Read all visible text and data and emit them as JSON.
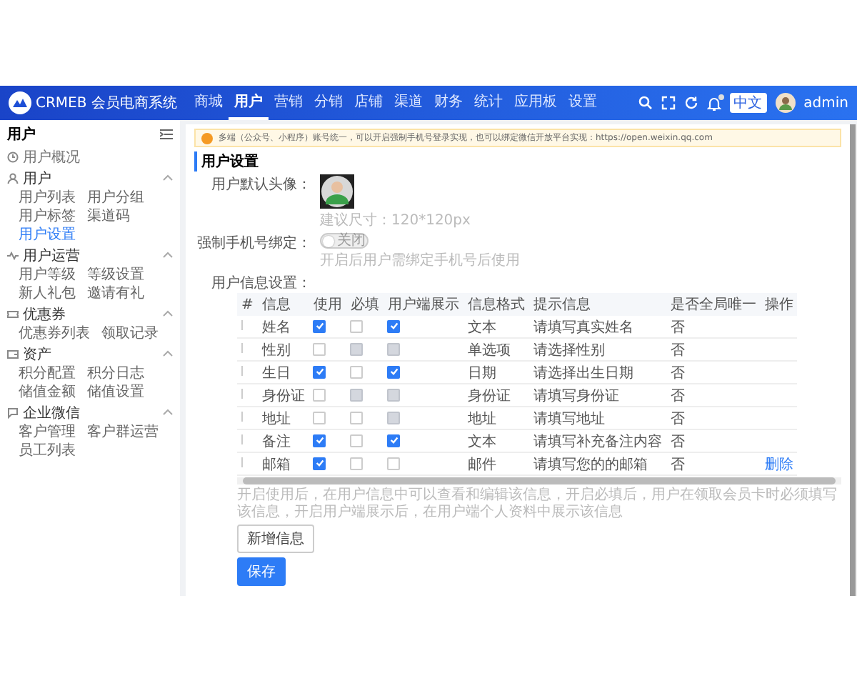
{
  "header": {
    "logo_text": "CRMEB 会员电商系统",
    "nav": [
      {
        "label": "商城",
        "selected": false
      },
      {
        "label": "用户",
        "selected": true
      },
      {
        "label": "营销",
        "selected": false
      },
      {
        "label": "分销",
        "selected": false
      },
      {
        "label": "店铺",
        "selected": false
      },
      {
        "label": "渠道",
        "selected": false
      },
      {
        "label": "财务",
        "selected": false
      },
      {
        "label": "统计",
        "selected": false
      },
      {
        "label": "应用板",
        "selected": false
      },
      {
        "label": "设置",
        "selected": false
      }
    ],
    "notification_dot": true,
    "tag": "中文",
    "user": "admin"
  },
  "sidebar": {
    "title": "用户",
    "groups": [
      {
        "label": "用户概况"
      },
      {
        "label": "用户",
        "expanded": true,
        "items": [
          {
            "label": "用户列表",
            "selected": false
          },
          {
            "label": "用户分组",
            "selected": false
          },
          {
            "label": "用户标签",
            "selected": false
          },
          {
            "label": "渠道码",
            "selected": false
          },
          {
            "label": "用户设置",
            "selected": true
          }
        ]
      },
      {
        "label": "用户运营",
        "expanded": true,
        "items": [
          {
            "label": "用户等级",
            "selected": false
          },
          {
            "label": "等级设置",
            "selected": false
          },
          {
            "label": "新人礼包",
            "selected": false
          },
          {
            "label": "邀请有礼",
            "selected": false
          }
        ]
      },
      {
        "label": "优惠券",
        "expanded": true,
        "items": [
          {
            "label": "优惠券列表",
            "selected": false
          },
          {
            "label": "领取记录",
            "selected": false
          }
        ]
      },
      {
        "label": "资产",
        "expanded": true,
        "items": [
          {
            "label": "积分配置",
            "selected": false
          },
          {
            "label": "积分日志",
            "selected": false
          },
          {
            "label": "储值金额",
            "selected": false
          },
          {
            "label": "储值设置",
            "selected": false
          }
        ]
      },
      {
        "label": "企业微信",
        "expanded": true,
        "items": [
          {
            "label": "客户管理",
            "selected": false
          },
          {
            "label": "客户群运营",
            "selected": false
          },
          {
            "label": "员工列表",
            "selected": false
          }
        ]
      }
    ]
  },
  "notice": "多端（公众号、小程序）账号统一，可以开启强制手机号登录实现，也可以绑定微信开放平台实现：https://open.weixin.qq.com",
  "section_title": "用户设置",
  "avatar": {
    "label": "用户默认头像：",
    "hint": "建议尺寸：120*120px"
  },
  "phone_toggle": {
    "label": "强制手机号绑定：",
    "on": false,
    "text": "关闭",
    "hint": "开启后用户需绑定手机号后使用"
  },
  "info_label": "用户信息设置：",
  "table": {
    "columns": [
      "#",
      "信息",
      "使用",
      "必填",
      "用户端展示",
      "信息格式",
      "提示信息",
      "是否全局唯一",
      "操作"
    ],
    "rows": [
      {
        "name": "姓名",
        "use": {
          "checked": true,
          "disabled": false
        },
        "required": {
          "checked": false,
          "disabled": false
        },
        "display": {
          "checked": true,
          "disabled": false
        },
        "format": "文本",
        "hint": "请填写真实姓名",
        "unique": "否"
      },
      {
        "name": "性别",
        "use": {
          "checked": false,
          "disabled": false
        },
        "required": {
          "checked": false,
          "disabled": true
        },
        "display": {
          "checked": false,
          "disabled": true
        },
        "format": "单选项",
        "hint": "请选择性别",
        "unique": "否"
      },
      {
        "name": "生日",
        "use": {
          "checked": true,
          "disabled": false
        },
        "required": {
          "checked": false,
          "disabled": false
        },
        "display": {
          "checked": true,
          "disabled": false
        },
        "format": "日期",
        "hint": "请选择出生日期",
        "unique": "否"
      },
      {
        "name": "身份证",
        "use": {
          "checked": false,
          "disabled": false
        },
        "required": {
          "checked": false,
          "disabled": true
        },
        "display": {
          "checked": false,
          "disabled": true
        },
        "format": "身份证",
        "hint": "请填写身份证",
        "unique": "否"
      },
      {
        "name": "地址",
        "use": {
          "checked": false,
          "disabled": false
        },
        "required": {
          "checked": false,
          "disabled": false
        },
        "display": {
          "checked": false,
          "disabled": true
        },
        "format": "地址",
        "hint": "请填写地址",
        "unique": "否"
      },
      {
        "name": "备注",
        "use": {
          "checked": true,
          "disabled": false
        },
        "required": {
          "checked": false,
          "disabled": false
        },
        "display": {
          "checked": true,
          "disabled": false
        },
        "format": "文本",
        "hint": "请填写补充备注内容",
        "unique": "否"
      },
      {
        "name": "邮箱",
        "use": {
          "checked": true,
          "disabled": false
        },
        "required": {
          "checked": false,
          "disabled": false
        },
        "display": {
          "checked": false,
          "disabled": false
        },
        "format": "邮件",
        "hint": "请填写您的的邮箱",
        "unique": "否",
        "action": "删除"
      }
    ]
  },
  "table_hint": "开启使用后，在用户信息中可以查看和编辑该信息，开启必填后，用户在领取会员卡时必须填写该信息，开启用户端展示后，在用户端个人资料中展示该信息",
  "add_button": "新增信息",
  "save_button": "保存"
}
